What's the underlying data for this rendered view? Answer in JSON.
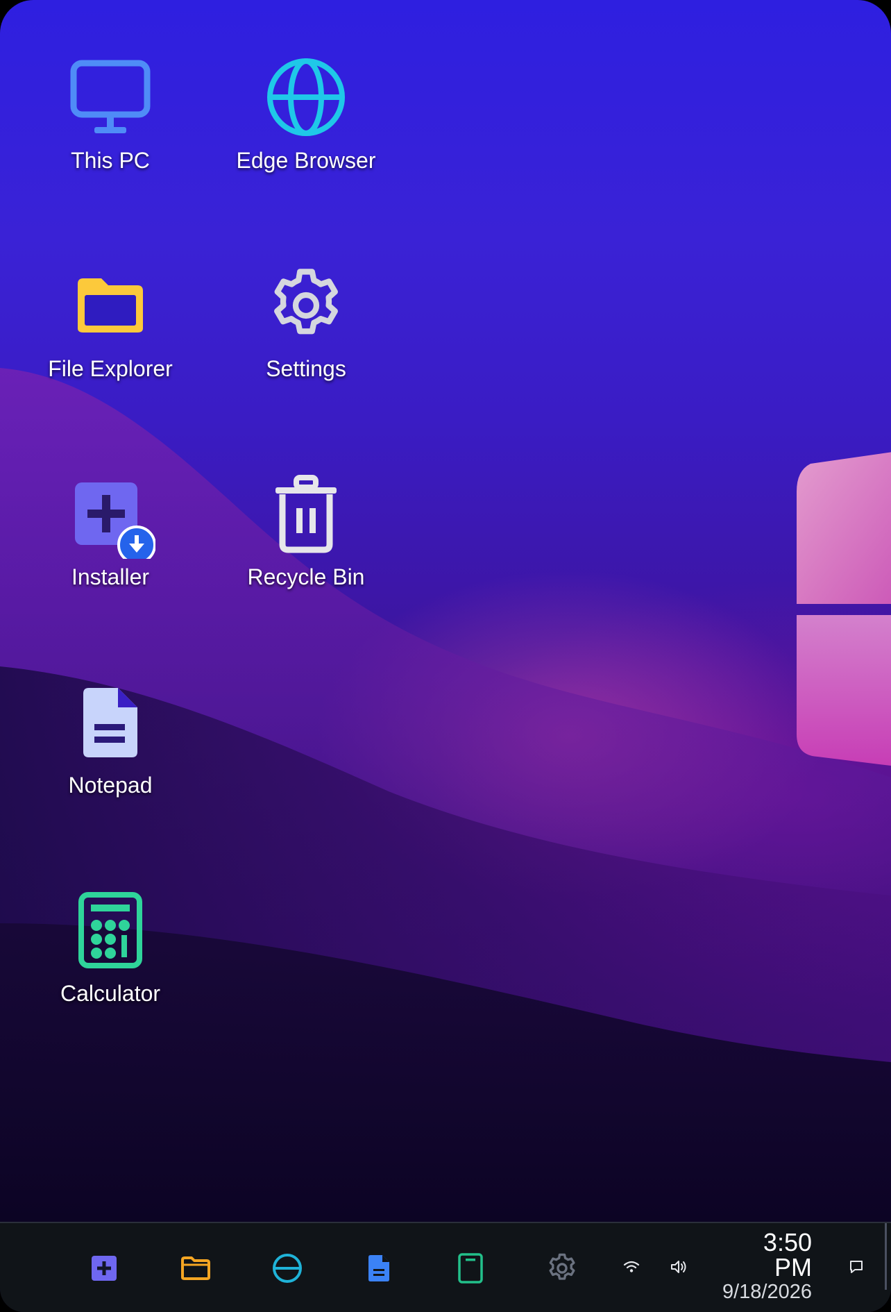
{
  "desktop": {
    "icons": [
      {
        "label": "This PC",
        "icon": "monitor-icon",
        "color": "#4f8cf7"
      },
      {
        "label": "Edge Browser",
        "icon": "globe-icon",
        "color": "#1fc8e8"
      },
      {
        "label": "File Explorer",
        "icon": "folder-icon",
        "color": "#fcc93b"
      },
      {
        "label": "Settings",
        "icon": "gear-icon",
        "color": "#d5d7de"
      },
      {
        "label": "Installer",
        "icon": "installer-icon",
        "color": "#6f67f0"
      },
      {
        "label": "Recycle Bin",
        "icon": "trash-icon",
        "color": "#e6e6ea"
      },
      {
        "label": "Notepad",
        "icon": "document-icon",
        "color": "#c8d4fb"
      },
      {
        "label": "Calculator",
        "icon": "calculator-icon",
        "color": "#2fd49a"
      }
    ]
  },
  "taskbar": {
    "apps": [
      {
        "icon": "installer-icon",
        "color": "#6f67f0"
      },
      {
        "icon": "folder-icon",
        "color": "#f5a623"
      },
      {
        "icon": "browser-icon",
        "color": "#1fb3d8"
      },
      {
        "icon": "document-icon",
        "color": "#3b82f6"
      },
      {
        "icon": "calculator-icon",
        "color": "#22c08a"
      },
      {
        "icon": "gear-icon",
        "color": "#6b7280"
      }
    ],
    "tray": {
      "wifi_icon": "wifi-icon",
      "volume_icon": "volume-icon",
      "time": "3:50",
      "ampm": "PM",
      "date": "9/18/2026",
      "notification_icon": "notification-icon"
    }
  },
  "theme": {
    "taskbar_bg": "#101418"
  }
}
